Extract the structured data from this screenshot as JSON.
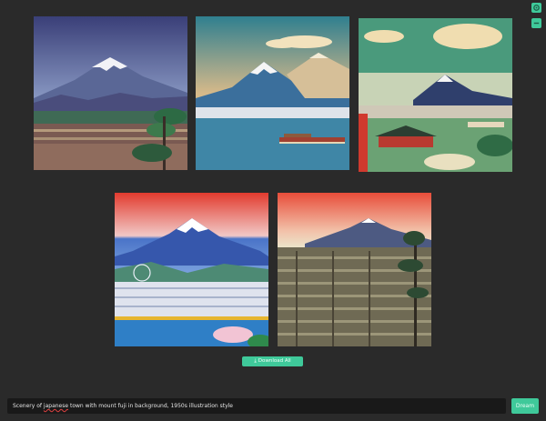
{
  "toolbar": {
    "settings_icon": "gear-icon",
    "collapse_icon": "minus-icon"
  },
  "gallery": {
    "images": [
      {
        "name": "result-image-1",
        "description_icon": "image"
      },
      {
        "name": "result-image-2",
        "description_icon": "image"
      },
      {
        "name": "result-image-3",
        "description_icon": "image"
      },
      {
        "name": "result-image-4",
        "description_icon": "image"
      },
      {
        "name": "result-image-5",
        "description_icon": "image"
      }
    ]
  },
  "download": {
    "label": "Download All",
    "icon": "download-icon"
  },
  "prompt": {
    "before": "Scenery of ",
    "misspelled_word": "japanese",
    "after": " town with mount fuji in background, 1950s illustration style"
  },
  "dream": {
    "label": "Dream"
  },
  "colors": {
    "accent": "#3fc99a",
    "background": "#2a2a2a",
    "input_background": "#191919"
  }
}
